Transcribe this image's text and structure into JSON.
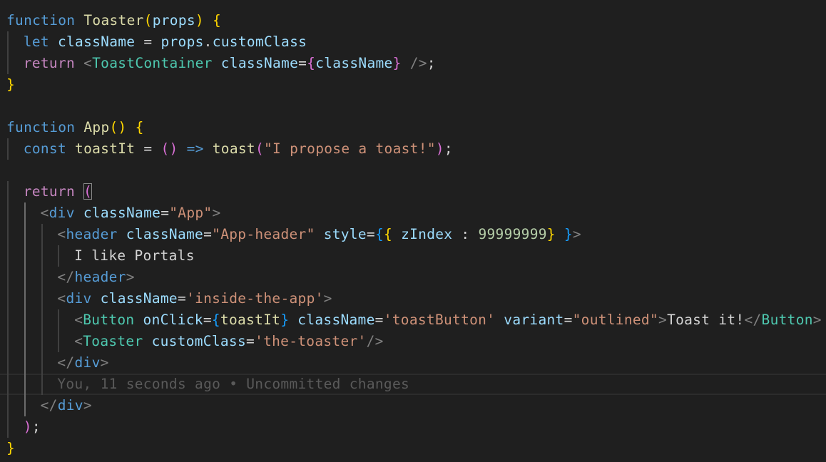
{
  "blame": {
    "author": "You",
    "time": "11 seconds ago",
    "separator": "•",
    "message": "Uncommitted changes"
  },
  "lines": [
    {
      "indent": 0,
      "tokens": [
        {
          "t": "function",
          "c": "kw"
        },
        {
          "t": " ",
          "c": "plain"
        },
        {
          "t": "Toaster",
          "c": "fn"
        },
        {
          "t": "(",
          "c": "b1"
        },
        {
          "t": "props",
          "c": "var"
        },
        {
          "t": ")",
          "c": "b1"
        },
        {
          "t": " ",
          "c": "plain"
        },
        {
          "t": "{",
          "c": "b1"
        }
      ]
    },
    {
      "indent": 1,
      "tokens": [
        {
          "t": "let",
          "c": "kw"
        },
        {
          "t": " ",
          "c": "plain"
        },
        {
          "t": "className",
          "c": "var"
        },
        {
          "t": " = ",
          "c": "plain"
        },
        {
          "t": "props",
          "c": "var"
        },
        {
          "t": ".",
          "c": "plain"
        },
        {
          "t": "customClass",
          "c": "var"
        }
      ]
    },
    {
      "indent": 1,
      "tokens": [
        {
          "t": "return",
          "c": "ctl"
        },
        {
          "t": " ",
          "c": "plain"
        },
        {
          "t": "<",
          "c": "angle"
        },
        {
          "t": "ToastContainer",
          "c": "tag"
        },
        {
          "t": " ",
          "c": "plain"
        },
        {
          "t": "className",
          "c": "attr"
        },
        {
          "t": "=",
          "c": "plain"
        },
        {
          "t": "{",
          "c": "b2"
        },
        {
          "t": "className",
          "c": "var"
        },
        {
          "t": "}",
          "c": "b2"
        },
        {
          "t": " ",
          "c": "plain"
        },
        {
          "t": "/>",
          "c": "angle"
        },
        {
          "t": ";",
          "c": "plain"
        }
      ]
    },
    {
      "indent": 0,
      "tokens": [
        {
          "t": "}",
          "c": "b1"
        }
      ]
    },
    {
      "indent": 0,
      "tokens": []
    },
    {
      "indent": 0,
      "tokens": [
        {
          "t": "function",
          "c": "kw"
        },
        {
          "t": " ",
          "c": "plain"
        },
        {
          "t": "App",
          "c": "fn"
        },
        {
          "t": "()",
          "c": "b1"
        },
        {
          "t": " ",
          "c": "plain"
        },
        {
          "t": "{",
          "c": "b1"
        }
      ]
    },
    {
      "indent": 1,
      "tokens": [
        {
          "t": "const",
          "c": "kw"
        },
        {
          "t": " ",
          "c": "plain"
        },
        {
          "t": "toastIt",
          "c": "fn"
        },
        {
          "t": " = ",
          "c": "plain"
        },
        {
          "t": "()",
          "c": "b2"
        },
        {
          "t": " ",
          "c": "plain"
        },
        {
          "t": "=>",
          "c": "kw"
        },
        {
          "t": " ",
          "c": "plain"
        },
        {
          "t": "toast",
          "c": "fn"
        },
        {
          "t": "(",
          "c": "b2"
        },
        {
          "t": "\"I propose a toast!\"",
          "c": "str"
        },
        {
          "t": ")",
          "c": "b2"
        },
        {
          "t": ";",
          "c": "plain"
        }
      ]
    },
    {
      "indent": 0,
      "tokens": []
    },
    {
      "indent": 1,
      "tokens": [
        {
          "t": "return",
          "c": "ctl"
        },
        {
          "t": " ",
          "c": "plain"
        },
        {
          "t": "(",
          "c": "b2",
          "cursor": true
        }
      ]
    },
    {
      "indent": 2,
      "tokens": [
        {
          "t": "<",
          "c": "angle"
        },
        {
          "t": "div",
          "c": "htmltag"
        },
        {
          "t": " ",
          "c": "plain"
        },
        {
          "t": "className",
          "c": "attr"
        },
        {
          "t": "=",
          "c": "plain"
        },
        {
          "t": "\"App\"",
          "c": "str"
        },
        {
          "t": ">",
          "c": "angle"
        }
      ]
    },
    {
      "indent": 3,
      "tokens": [
        {
          "t": "<",
          "c": "angle"
        },
        {
          "t": "header",
          "c": "htmltag"
        },
        {
          "t": " ",
          "c": "plain"
        },
        {
          "t": "className",
          "c": "attr"
        },
        {
          "t": "=",
          "c": "plain"
        },
        {
          "t": "\"App-header\"",
          "c": "str"
        },
        {
          "t": " ",
          "c": "plain"
        },
        {
          "t": "style",
          "c": "attr"
        },
        {
          "t": "=",
          "c": "plain"
        },
        {
          "t": "{",
          "c": "b3"
        },
        {
          "t": "{",
          "c": "b1"
        },
        {
          "t": " ",
          "c": "plain"
        },
        {
          "t": "zIndex",
          "c": "var"
        },
        {
          "t": " : ",
          "c": "plain"
        },
        {
          "t": "99999999",
          "c": "num"
        },
        {
          "t": "}",
          "c": "b1"
        },
        {
          "t": " ",
          "c": "plain"
        },
        {
          "t": "}",
          "c": "b3"
        },
        {
          "t": ">",
          "c": "angle"
        }
      ]
    },
    {
      "indent": 4,
      "tokens": [
        {
          "t": "I like Portals",
          "c": "text"
        }
      ]
    },
    {
      "indent": 3,
      "tokens": [
        {
          "t": "</",
          "c": "angle"
        },
        {
          "t": "header",
          "c": "htmltag"
        },
        {
          "t": ">",
          "c": "angle"
        }
      ]
    },
    {
      "indent": 3,
      "tokens": [
        {
          "t": "<",
          "c": "angle"
        },
        {
          "t": "div",
          "c": "htmltag"
        },
        {
          "t": " ",
          "c": "plain"
        },
        {
          "t": "className",
          "c": "attr"
        },
        {
          "t": "=",
          "c": "plain"
        },
        {
          "t": "'inside-the-app'",
          "c": "str"
        },
        {
          "t": ">",
          "c": "angle"
        }
      ]
    },
    {
      "indent": 4,
      "tokens": [
        {
          "t": "<",
          "c": "angle"
        },
        {
          "t": "Button",
          "c": "tag"
        },
        {
          "t": " ",
          "c": "plain"
        },
        {
          "t": "onClick",
          "c": "attr"
        },
        {
          "t": "=",
          "c": "plain"
        },
        {
          "t": "{",
          "c": "b3"
        },
        {
          "t": "toastIt",
          "c": "fn"
        },
        {
          "t": "}",
          "c": "b3"
        },
        {
          "t": " ",
          "c": "plain"
        },
        {
          "t": "className",
          "c": "attr"
        },
        {
          "t": "=",
          "c": "plain"
        },
        {
          "t": "'toastButton'",
          "c": "str"
        },
        {
          "t": " ",
          "c": "plain"
        },
        {
          "t": "variant",
          "c": "attr"
        },
        {
          "t": "=",
          "c": "plain"
        },
        {
          "t": "\"outlined\"",
          "c": "str"
        },
        {
          "t": ">",
          "c": "angle"
        },
        {
          "t": "Toast it!",
          "c": "text"
        },
        {
          "t": "</",
          "c": "angle"
        },
        {
          "t": "Button",
          "c": "tag"
        },
        {
          "t": ">",
          "c": "angle"
        }
      ]
    },
    {
      "indent": 4,
      "tokens": [
        {
          "t": "<",
          "c": "angle"
        },
        {
          "t": "Toaster",
          "c": "tag"
        },
        {
          "t": " ",
          "c": "plain"
        },
        {
          "t": "customClass",
          "c": "attr"
        },
        {
          "t": "=",
          "c": "plain"
        },
        {
          "t": "'the-toaster'",
          "c": "str"
        },
        {
          "t": "/>",
          "c": "angle"
        }
      ]
    },
    {
      "indent": 3,
      "tokens": [
        {
          "t": "</",
          "c": "angle"
        },
        {
          "t": "div",
          "c": "htmltag"
        },
        {
          "t": ">",
          "c": "angle"
        }
      ]
    },
    {
      "indent": 3,
      "current": true,
      "tokens": [
        {
          "t": "You, 11 seconds ago • Uncommitted changes",
          "c": "blame"
        }
      ]
    },
    {
      "indent": 2,
      "tokens": [
        {
          "t": "</",
          "c": "angle"
        },
        {
          "t": "div",
          "c": "htmltag"
        },
        {
          "t": ">",
          "c": "angle"
        }
      ]
    },
    {
      "indent": 1,
      "tokens": [
        {
          "t": ")",
          "c": "b2"
        },
        {
          "t": ";",
          "c": "plain"
        }
      ]
    },
    {
      "indent": 0,
      "tokens": [
        {
          "t": "}",
          "c": "b1"
        }
      ]
    }
  ]
}
